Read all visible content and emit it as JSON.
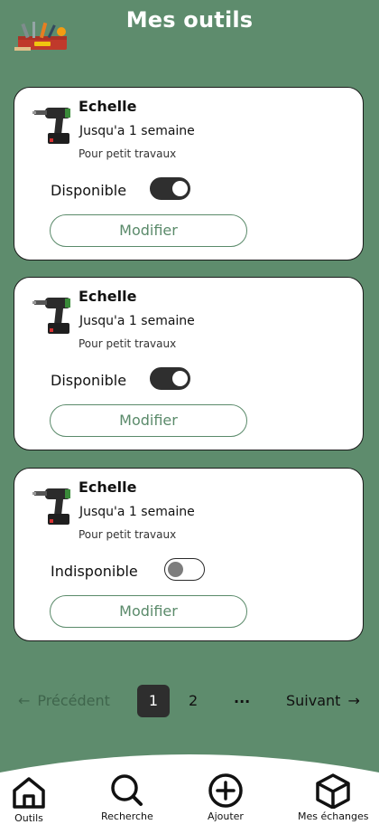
{
  "header": {
    "title": "Mes outils",
    "logo_icon": "toolbox-icon"
  },
  "cards": [
    {
      "name": "Echelle",
      "duration": "Jusqu'a 1 semaine",
      "description": "Pour petit travaux",
      "status_label": "Disponible",
      "available": true,
      "button_label": "Modifier"
    },
    {
      "name": "Echelle",
      "duration": "Jusqu'a 1 semaine",
      "description": "Pour petit travaux",
      "status_label": "Disponible",
      "available": true,
      "button_label": "Modifier"
    },
    {
      "name": "Echelle",
      "duration": "Jusqu'a 1 semaine",
      "description": "Pour petit travaux",
      "status_label": "Indisponible",
      "available": false,
      "button_label": "Modifier"
    }
  ],
  "pagination": {
    "prev_label": "Précédent",
    "current_page": "1",
    "next_page": "2",
    "ellipsis": "...",
    "next_label": "Suivant",
    "prev_arrow": "←",
    "next_arrow": "→"
  },
  "nav": [
    {
      "label": "Outils",
      "icon": "home-icon"
    },
    {
      "label": "Recherche",
      "icon": "search-icon"
    },
    {
      "label": "Ajouter",
      "icon": "add-circle-icon"
    },
    {
      "label": "Mes échanges",
      "icon": "box-icon"
    }
  ],
  "colors": {
    "background": "#5e8c6d",
    "accent": "#5a8a6a",
    "toggle_on": "#2f2f2f",
    "card": "#ffffff"
  }
}
